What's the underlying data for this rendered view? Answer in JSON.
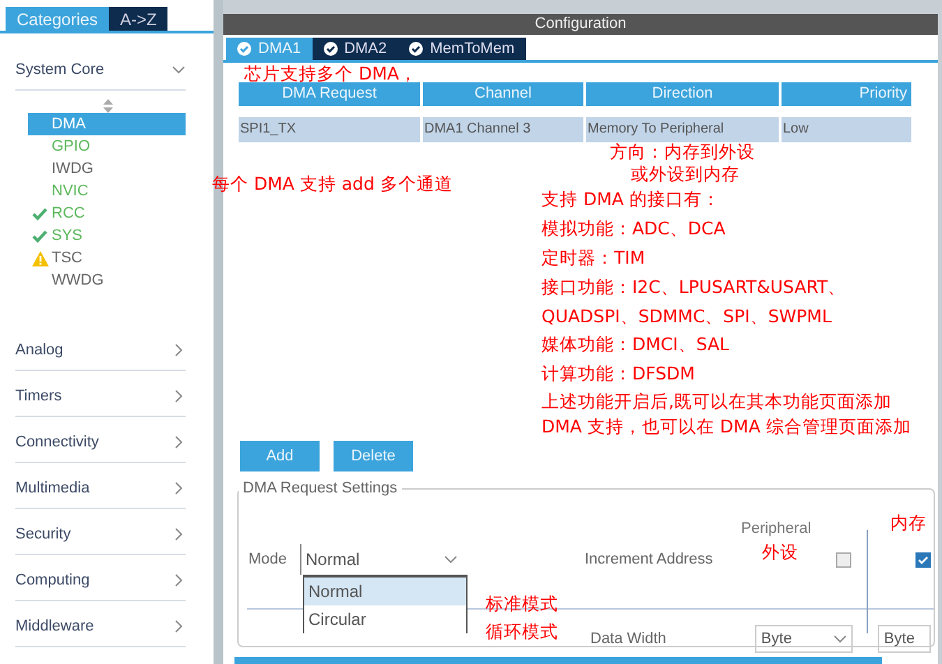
{
  "sidebar": {
    "tabs": [
      {
        "label": "Categories",
        "selected": true
      },
      {
        "label": "A->Z",
        "selected": false
      }
    ],
    "groups": [
      {
        "label": "System Core",
        "expanded": true,
        "items": [
          {
            "label": "DMA",
            "selected": true,
            "configured": false
          },
          {
            "label": "GPIO",
            "selected": false,
            "configured": true
          },
          {
            "label": "IWDG",
            "selected": false,
            "configured": false
          },
          {
            "label": "NVIC",
            "selected": false,
            "configured": true
          },
          {
            "label": "RCC",
            "selected": false,
            "configured": true,
            "kind": "check"
          },
          {
            "label": "SYS",
            "selected": false,
            "configured": true,
            "kind": "check"
          },
          {
            "label": "TSC",
            "selected": false,
            "configured": false,
            "kind": "warning"
          },
          {
            "label": "WWDG",
            "selected": false,
            "configured": false
          }
        ]
      },
      {
        "label": "Analog",
        "expanded": false
      },
      {
        "label": "Timers",
        "expanded": false
      },
      {
        "label": "Connectivity",
        "expanded": false
      },
      {
        "label": "Multimedia",
        "expanded": false
      },
      {
        "label": "Security",
        "expanded": false
      },
      {
        "label": "Computing",
        "expanded": false
      },
      {
        "label": "Middleware",
        "expanded": false
      }
    ]
  },
  "configuration": {
    "title": "Configuration",
    "tabs": [
      {
        "label": "DMA1",
        "selected": true
      },
      {
        "label": "DMA2",
        "selected": false
      },
      {
        "label": "MemToMem",
        "selected": false
      }
    ],
    "table": {
      "columns": [
        "DMA Request",
        "Channel",
        "Direction",
        "Priority"
      ],
      "rows": [
        {
          "cells": [
            "SPI1_TX",
            "DMA1 Channel 3",
            "Memory To Peripheral",
            "Low"
          ],
          "selected": true
        }
      ]
    },
    "buttons": [
      "Add",
      "Delete"
    ],
    "settings": {
      "title": "DMA Request Settings",
      "mode_label": "Mode",
      "mode_value": "Normal",
      "mode_options": [
        {
          "label": "Normal",
          "selected": true
        },
        {
          "label": "Circular",
          "selected": false
        }
      ],
      "increment_label": "Increment Address",
      "peripheral_header": "Peripheral",
      "peripheral_checked": false,
      "memory_checked": true,
      "data_width_label": "Data Width",
      "peripheral_width": "Byte",
      "memory_width": "Byte"
    }
  },
  "annotations": [
    {
      "text": "芯片支持多个 DMA，"
    },
    {
      "text": "方向：内存到外设"
    },
    {
      "text": "或外设到内存"
    },
    {
      "text": "每个 DMA 支持 add 多个通道"
    },
    {
      "text": "支持 DMA 的接口有："
    },
    {
      "text": "模拟功能：ADC、DCA"
    },
    {
      "text": "定时器：TIM"
    },
    {
      "text": "接口功能：I2C、LPUSART&USART、"
    },
    {
      "text": "QUADSPI、SDMMC、SPI、SWPML"
    },
    {
      "text": "媒体功能：DMCI、SAL"
    },
    {
      "text": "计算功能：DFSDM"
    },
    {
      "text": "上述功能开启后,既可以在其本功能页面添加DMA 支持，也可以在 DMA 综合管理页面添加"
    },
    {
      "text": "标准模式"
    },
    {
      "text": "循环模式"
    },
    {
      "text": "外设"
    },
    {
      "text": "内存"
    }
  ]
}
